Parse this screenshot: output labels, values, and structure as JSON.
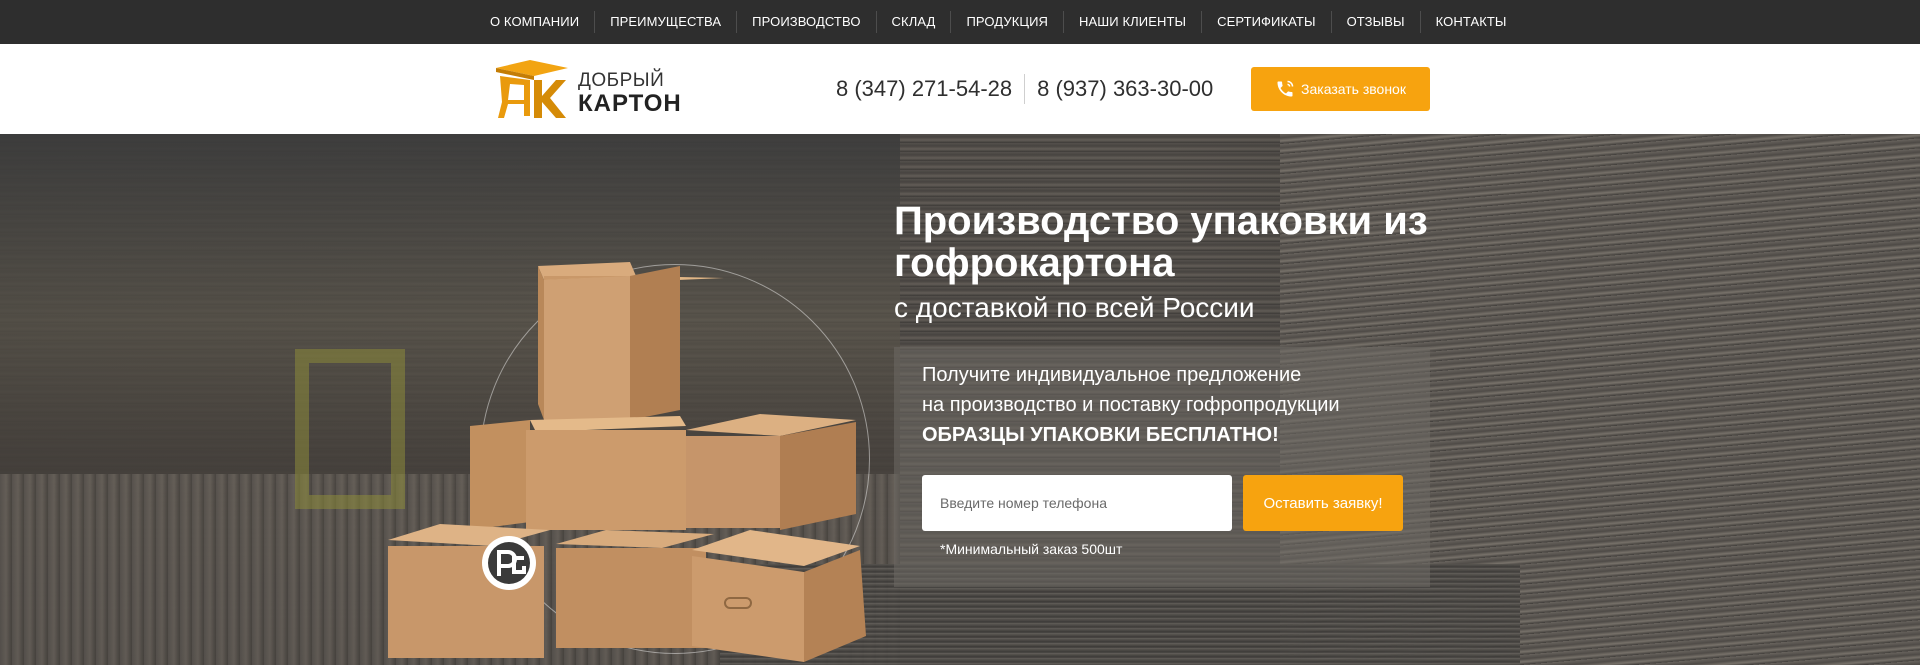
{
  "nav": {
    "items": [
      {
        "label": "О КОМПАНИИ"
      },
      {
        "label": "ПРЕИМУЩЕСТВА"
      },
      {
        "label": "ПРОИЗВОДСТВО"
      },
      {
        "label": "СКЛАД"
      },
      {
        "label": "ПРОДУКЦИЯ"
      },
      {
        "label": "НАШИ КЛИЕНТЫ"
      },
      {
        "label": "СЕРТИФИКАТЫ"
      },
      {
        "label": "ОТЗЫВЫ"
      },
      {
        "label": "КОНТАКТЫ"
      }
    ]
  },
  "header": {
    "logo_line1": "ДОБРЫЙ",
    "logo_line2": "КАРТОН",
    "phone1": "8 (347) 271-54-28",
    "phone2": "8 (937) 363-30-00",
    "callback_label": "Заказать звонок",
    "callback_icon": "phone-icon"
  },
  "hero": {
    "title": "Производство упаковки из гофрокартона",
    "subtitle": "с доставкой по всей России",
    "offer_line1": "Получите индивидуальное предложение",
    "offer_line2": "на производство и поставку гофропродукции",
    "offer_line3": "ОБРАЗЦЫ УПАКОВКИ БЕСПЛАТНО!",
    "input_placeholder": "Введите номер телефона",
    "submit_label": "Оставить заявку!",
    "min_order": "*Минимальный заказ 500шт"
  },
  "colors": {
    "accent": "#f7a30f",
    "topbar": "#2e2e2e",
    "header_bg": "#ffffff"
  }
}
